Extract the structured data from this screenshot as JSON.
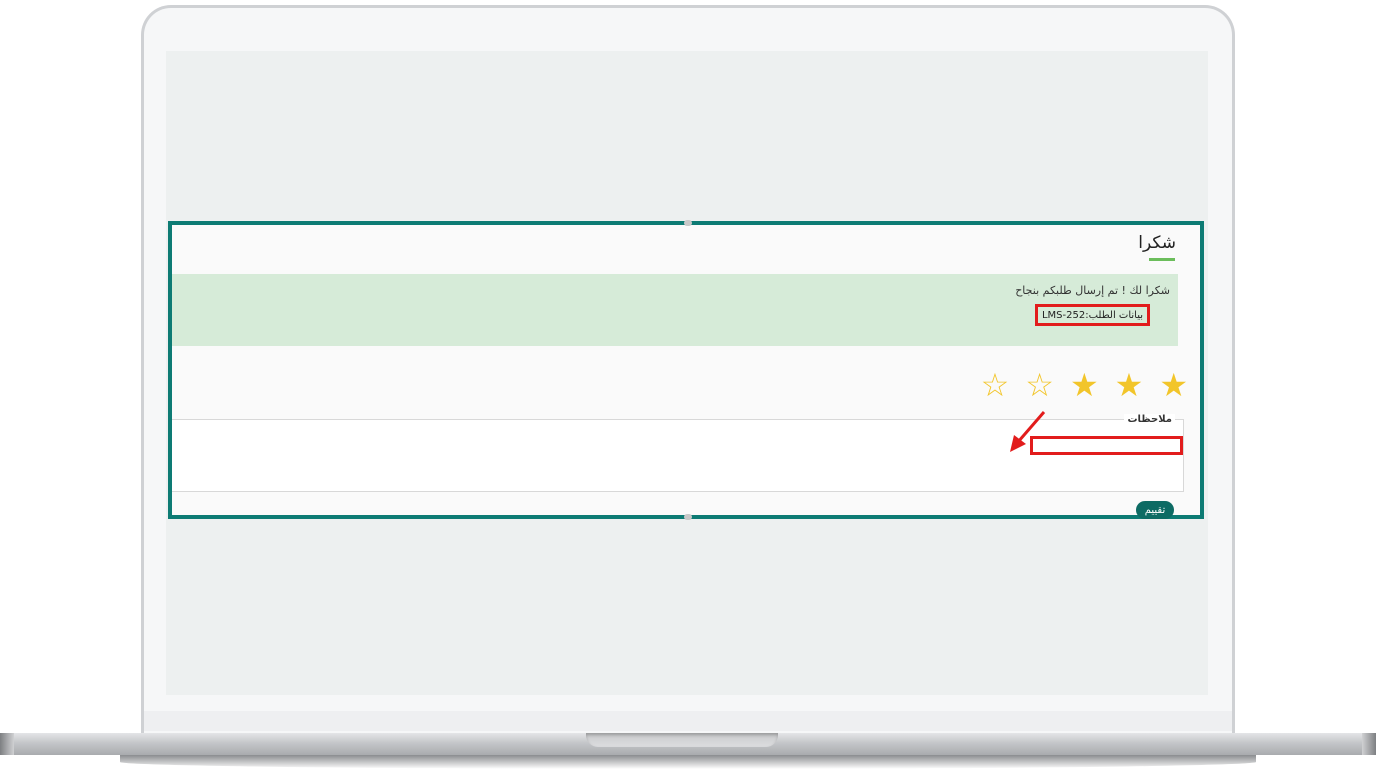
{
  "page": {
    "title": "شكرا",
    "alert_message": "شكرا لك ! تم إرسال طلبكم بنجاح",
    "request_info": "بيانات الطلب:LMS-252"
  },
  "rating": {
    "stars_filled": 3,
    "stars_total": 5,
    "star_filled_glyph": "★",
    "star_empty_glyph": "☆"
  },
  "notes": {
    "label": "ملاحظات",
    "value": ""
  },
  "actions": {
    "rate_label": "تقييم"
  },
  "colors": {
    "panel_border": "#0d7b74",
    "alert_bg": "#d6ebd8",
    "highlight": "#e21c1c",
    "star": "#f2c52a",
    "button": "#0d6b64",
    "title_accent": "#6bbd5b"
  },
  "icons": {
    "pointer": "red-arrow-icon"
  }
}
